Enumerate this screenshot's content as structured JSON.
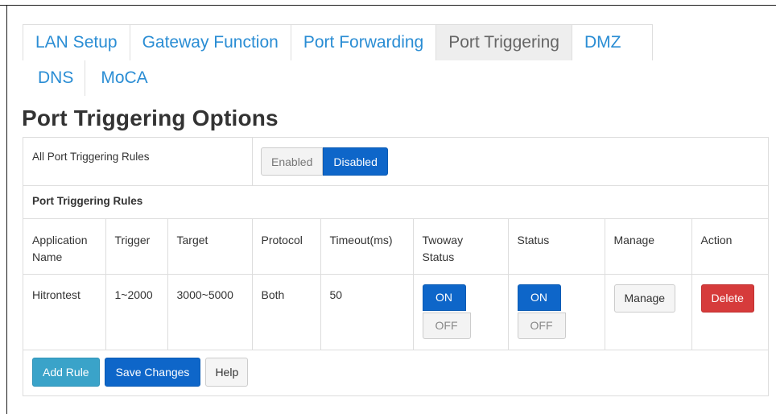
{
  "tabs": {
    "row1": [
      {
        "label": "LAN Setup",
        "active": false
      },
      {
        "label": "Gateway Function",
        "active": false
      },
      {
        "label": "Port Forwarding",
        "active": false
      },
      {
        "label": "Port Triggering",
        "active": true
      },
      {
        "label": "DMZ",
        "active": false
      }
    ],
    "row2": [
      {
        "label": "DNS"
      },
      {
        "label": "MoCA"
      }
    ]
  },
  "page_title": "Port Triggering Options",
  "all_rules": {
    "label": "All Port Triggering Rules",
    "enabled_label": "Enabled",
    "disabled_label": "Disabled",
    "selected": "Disabled"
  },
  "rules_section_title": "Port Triggering Rules",
  "table": {
    "headers": [
      "Application Name",
      "Trigger",
      "Target",
      "Protocol",
      "Timeout(ms)",
      "Twoway Status",
      "Status",
      "Manage",
      "Action"
    ],
    "rows": [
      {
        "application_name": "Hitrontest",
        "trigger": "1~2000",
        "target": "3000~5000",
        "protocol": "Both",
        "timeout": "50",
        "twoway_status": {
          "on_label": "ON",
          "off_label": "OFF",
          "value": "ON"
        },
        "status": {
          "on_label": "ON",
          "off_label": "OFF",
          "value": "ON"
        },
        "manage_label": "Manage",
        "delete_label": "Delete"
      }
    ]
  },
  "footer": {
    "add_rule_label": "Add Rule",
    "save_label": "Save Changes",
    "help_label": "Help"
  },
  "colors": {
    "tab_text": "#2a8dd4",
    "primary": "#0e66c9",
    "info": "#3aa3c9",
    "danger": "#d63b3b"
  }
}
